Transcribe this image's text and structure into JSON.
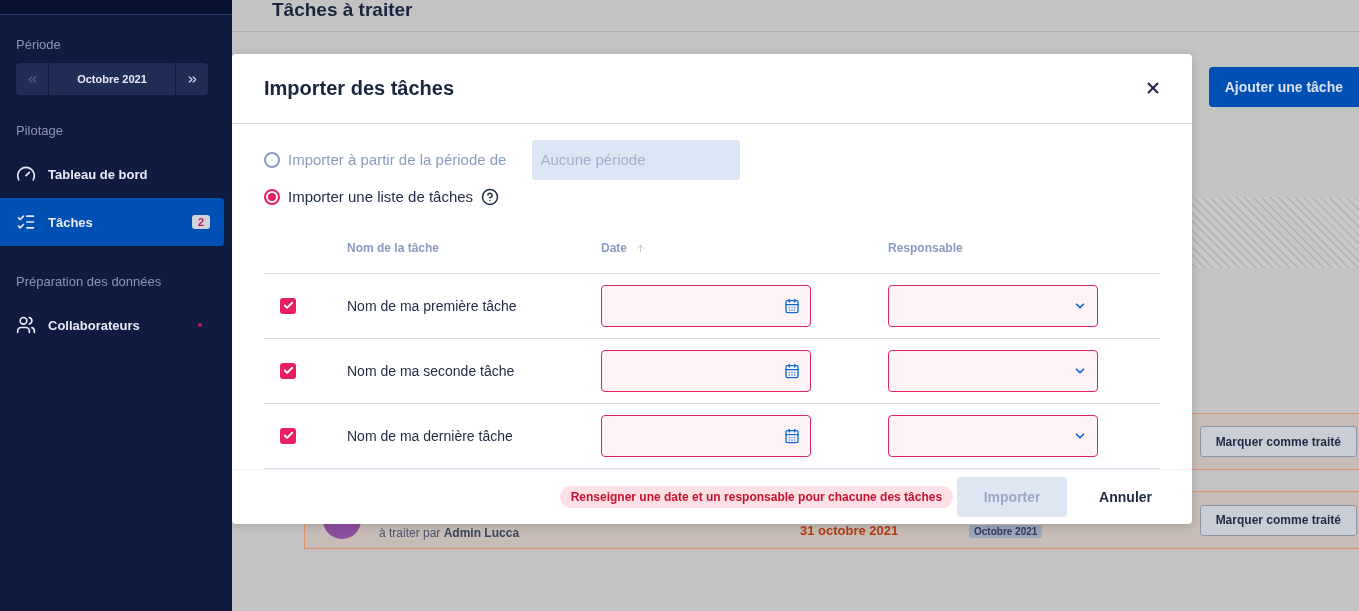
{
  "sidebar": {
    "period": {
      "label": "Période",
      "value": "Octobre 2021",
      "prev_disabled": true,
      "next_disabled": false
    },
    "sections": [
      {
        "title": "Pilotage",
        "items": [
          {
            "label": "Tableau de bord",
            "selected": false
          },
          {
            "label": "Tâches",
            "selected": true,
            "badge": "2"
          }
        ]
      },
      {
        "title": "Préparation des données",
        "items": [
          {
            "label": "Collaborateurs",
            "selected": false,
            "notification": true
          }
        ]
      }
    ]
  },
  "page": {
    "title": "Tâches à traiter",
    "add_button": "Ajouter une tâche",
    "cards": [
      {
        "button": "Marquer comme traité"
      },
      {
        "subtitle": "à traiter par **Admin Lucca**",
        "date": "31 octobre 2021",
        "period": "Octobre 2021",
        "button": "Marquer comme traité"
      }
    ]
  },
  "modal": {
    "title": "Importer des tâches",
    "options": [
      {
        "label": "Importer à partir de la période de",
        "selected": false,
        "placeholder": "Aucune période"
      },
      {
        "label": "Importer une liste de tâches",
        "selected": true,
        "help": true
      }
    ],
    "columns": [
      "Nom de la tâche",
      "Date",
      "Responsable"
    ],
    "rows": [
      {
        "name": "Nom de ma première tâche",
        "checked": true,
        "error": true
      },
      {
        "name": "Nom de ma seconde tâche",
        "checked": true,
        "error": true
      },
      {
        "name": "Nom de ma dernière tâche",
        "checked": true,
        "error": true
      }
    ],
    "message": "Renseigner une date et un responsable pour chacune des tâches",
    "import_button": {
      "label": "Importer",
      "disabled": true
    },
    "cancel_button": "Annuler"
  }
}
